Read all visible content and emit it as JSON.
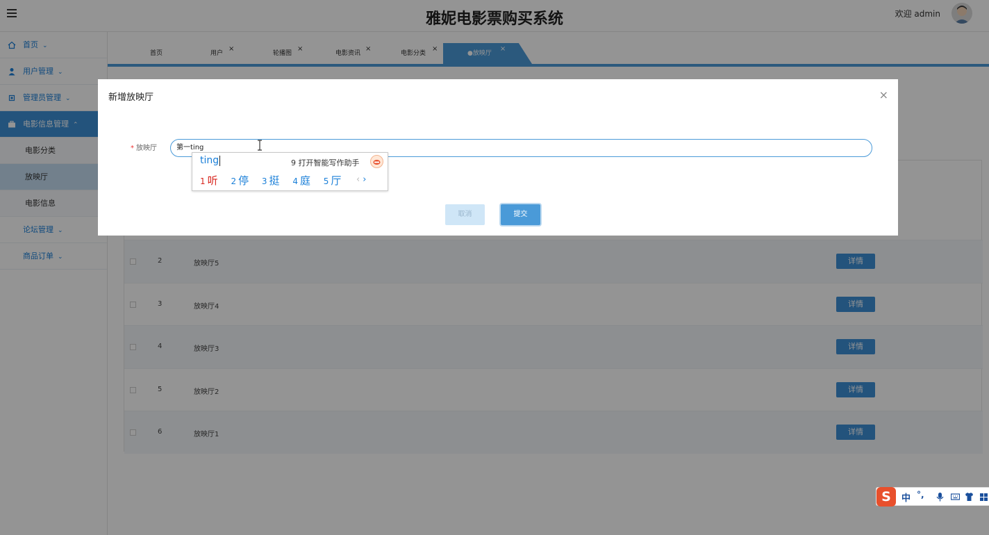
{
  "header": {
    "title": "雅妮电影票购买系统",
    "welcome": "欢迎 admin"
  },
  "sidebar": {
    "items": [
      {
        "label": "首页",
        "caret": "⌄"
      },
      {
        "label": "用户管理",
        "caret": "⌄"
      },
      {
        "label": "管理员管理",
        "caret": "⌄"
      },
      {
        "label": "电影信息管理",
        "caret": "⌃"
      },
      {
        "label": "论坛管理",
        "caret": "⌄"
      },
      {
        "label": "商品订单",
        "caret": "⌄"
      }
    ],
    "sub_items": [
      {
        "label": "电影分类"
      },
      {
        "label": "放映厅"
      },
      {
        "label": "电影信息"
      }
    ]
  },
  "tabs": [
    {
      "label": "首页"
    },
    {
      "label": "用户"
    },
    {
      "label": "轮播图"
    },
    {
      "label": "电影资讯"
    },
    {
      "label": "电影分类"
    }
  ],
  "active_tab": {
    "label": "●放映厅"
  },
  "tab_close_glyph": "×",
  "table": {
    "rows": [
      {
        "num": "2",
        "name": "放映厅5",
        "action": "详情"
      },
      {
        "num": "3",
        "name": "放映厅4",
        "action": "详情"
      },
      {
        "num": "4",
        "name": "放映厅3",
        "action": "详情"
      },
      {
        "num": "5",
        "name": "放映厅2",
        "action": "详情"
      },
      {
        "num": "6",
        "name": "放映厅1",
        "action": "详情"
      }
    ]
  },
  "dialog": {
    "title": "新增放映厅",
    "close": "×",
    "field_required": "*",
    "field_label": "放映厅",
    "field_value": "第一ting",
    "cancel": "取消",
    "submit": "提交"
  },
  "ime": {
    "composition": "ting",
    "assist_index": "9",
    "assist_label": "打开智能写作助手",
    "candidates": [
      {
        "index": "1",
        "text": "听"
      },
      {
        "index": "2",
        "text": "停"
      },
      {
        "index": "3",
        "text": "挺"
      },
      {
        "index": "4",
        "text": "庭"
      },
      {
        "index": "5",
        "text": "厅"
      }
    ],
    "prev": "‹",
    "next": "›"
  },
  "ime_bar": {
    "logo": "S",
    "mode": "中",
    "punct": "°,"
  },
  "colors": {
    "accent": "#4a9ad8",
    "active_nav": "#3d8fd6",
    "ime_first_candidate": "#d8241c",
    "ime_logo": "#e8502c"
  }
}
